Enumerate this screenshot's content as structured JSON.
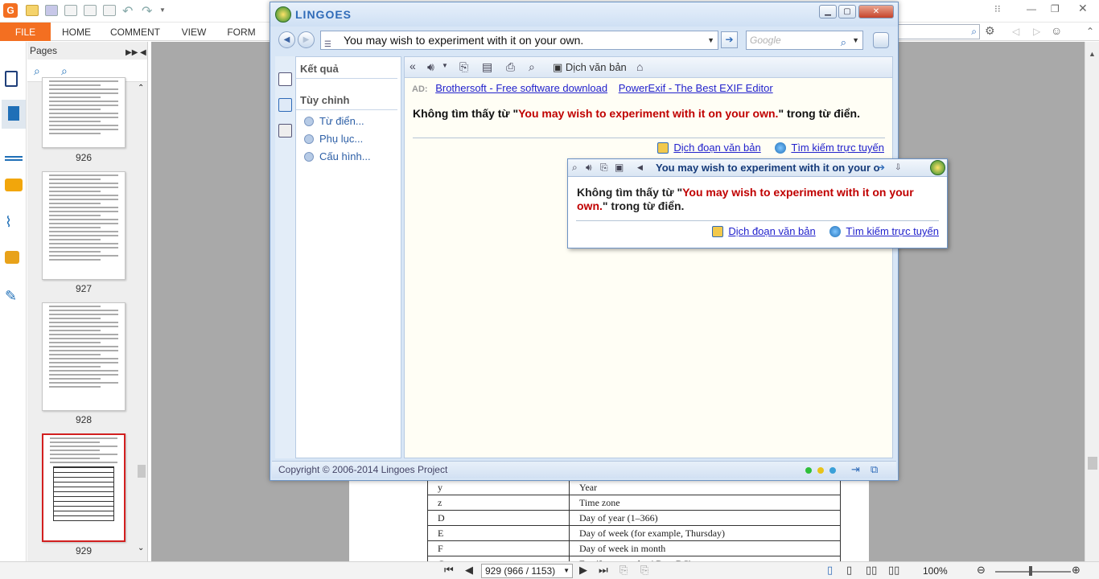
{
  "app": {
    "ribbon_tabs": [
      "FILE",
      "HOME",
      "COMMENT",
      "VIEW",
      "FORM"
    ],
    "search_partial": "d",
    "accent_color": "#f36f21"
  },
  "pages_panel": {
    "title": "Pages",
    "thumbnails": [
      {
        "page": "926",
        "selected": false
      },
      {
        "page": "927",
        "selected": false
      },
      {
        "page": "928",
        "selected": false
      },
      {
        "page": "929",
        "selected": true
      }
    ]
  },
  "document": {
    "table_rows": [
      [
        "y",
        "Year"
      ],
      [
        "z",
        "Time zone"
      ],
      [
        "D",
        "Day of year (1–366)"
      ],
      [
        "E",
        "Day of week (for example, Thursday)"
      ],
      [
        "F",
        "Day of week in month"
      ],
      [
        "G",
        "Era (for example, AD or BC)"
      ]
    ]
  },
  "status_bar": {
    "page_field": "929 (966 / 1153)",
    "zoom": "100%"
  },
  "lingoes": {
    "title": "LINGOES",
    "query": "You may wish to experiment with it on your own.",
    "google_placeholder": "Google",
    "left_panel": {
      "results_title": "Kết quả",
      "custom_title": "Tùy chỉnh",
      "links": [
        "Từ điển...",
        "Phụ lục...",
        "Cấu hình..."
      ]
    },
    "toolbar": {
      "collapse": "«",
      "translate_text": "Dịch văn bản"
    },
    "ad": {
      "label": "AD:",
      "links": [
        "Brothersoft - Free software download",
        "PowerExif - The Best EXIF Editor"
      ]
    },
    "result": {
      "prefix": "Không tìm thấy từ \"",
      "word": "You may wish to experiment with it on your own.",
      "suffix": "\" trong từ điển."
    },
    "actions": {
      "translate_paragraph": "Dịch đoạn văn bản",
      "search_online": "Tìm kiếm trực tuyến"
    },
    "copyright": "Copyright © 2006-2014 Lingoes Project",
    "status_dots": [
      "#2fbf3a",
      "#e8c31a",
      "#3aa0d8"
    ]
  },
  "popup": {
    "word": "You may wish to experiment with it on your own.",
    "result": {
      "prefix": "Không tìm thấy từ \"",
      "word": "You may wish to experiment with it on your own.",
      "suffix": "\" trong từ điển."
    },
    "actions": {
      "translate_paragraph": "Dịch đoạn văn bản",
      "search_online": "Tìm kiếm trực tuyến"
    }
  }
}
